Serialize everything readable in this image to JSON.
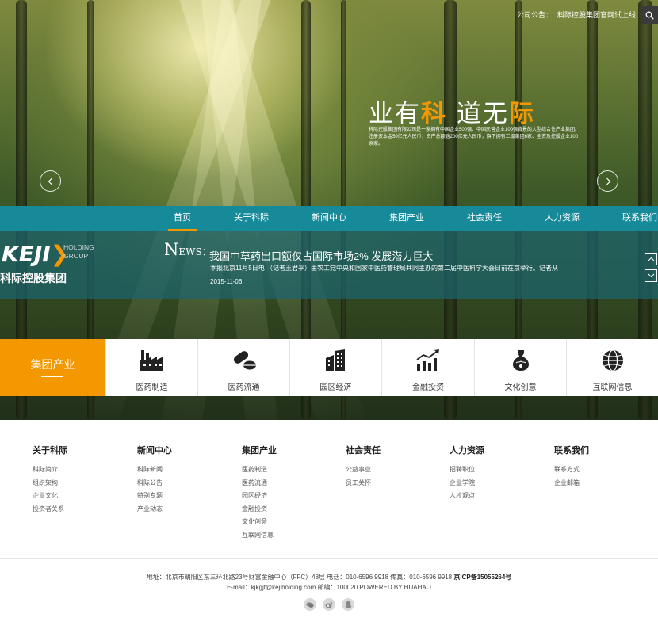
{
  "topbar": {
    "notice_label": "公司公告：",
    "notice_text": "科际控股集团官网试上线"
  },
  "hero": {
    "slogan_part1": "业有",
    "slogan_hl1": "科",
    "slogan_part2": " 道无",
    "slogan_hl2": "际",
    "slogan_desc": "科际控股集团有限公司是一家拥有中国企业500强、中国民营企业100强背景的大型综合性产业集团。注册资本金50亿元人民币，资产总额逾200亿元人民币，旗下拥有二级集团6家、全资及控股企业100余家。"
  },
  "nav": {
    "items": [
      {
        "label": "首页",
        "active": true
      },
      {
        "label": "关于科际",
        "active": false
      },
      {
        "label": "新闻中心",
        "active": false
      },
      {
        "label": "集团产业",
        "active": false
      },
      {
        "label": "社会责任",
        "active": false
      },
      {
        "label": "人力资源",
        "active": false
      },
      {
        "label": "联系我们",
        "active": false
      }
    ]
  },
  "logo": {
    "main_text": "KEJI",
    "sub_line1": "HOLDING",
    "sub_line2": "GROUP",
    "cn_name": "科际控股集团"
  },
  "news": {
    "tag_big": "N",
    "tag_rest": "EWS：",
    "title": "我国中草药出口额仅占国际市场2% 发展潜力巨大",
    "body": "本报北京11月5日电 （记者王君平）由农工党中央和国家中医药管理局共同主办的第二届中医科学大会日前在京举行。记者从",
    "date": "2015-11-06"
  },
  "industry": {
    "heading": "集团产业",
    "items": [
      {
        "label": "医药制造",
        "icon": "factory-icon"
      },
      {
        "label": "医药流通",
        "icon": "pills-icon"
      },
      {
        "label": "园区经济",
        "icon": "buildings-icon"
      },
      {
        "label": "金融投资",
        "icon": "bar-chart-icon"
      },
      {
        "label": "文化创意",
        "icon": "vase-icon"
      },
      {
        "label": "互联网信息",
        "icon": "globe-icon"
      }
    ]
  },
  "footer_links": {
    "columns": [
      {
        "title": "关于科际",
        "links": [
          "科际简介",
          "组织架构",
          "企业文化",
          "投资者关系"
        ]
      },
      {
        "title": "新闻中心",
        "links": [
          "科际新闻",
          "科际公告",
          "特别专题",
          "产业动态"
        ]
      },
      {
        "title": "集团产业",
        "links": [
          "医药制造",
          "医药流通",
          "园区经济",
          "金融投资",
          "文化创意",
          "互联网信息"
        ]
      },
      {
        "title": "社会责任",
        "links": [
          "公益事业",
          "员工关怀"
        ]
      },
      {
        "title": "人力资源",
        "links": [
          "招聘职位",
          "企业学院",
          "人才观点"
        ]
      },
      {
        "title": "联系我们",
        "links": [
          "联系方式",
          "企业邮箱"
        ]
      }
    ]
  },
  "copyright": {
    "line1_prefix": "地址：北京市朝阳区东三环北路23号财富金融中心（FFC）48层 电话：010-6596 9918 传真：010-6596 9918 ",
    "line1_icp": "京ICP备15055264号",
    "line2": "E-mail：kjkgjt@kejiholding.com 邮编：100020 POWERED BY HUAHAO"
  },
  "social": [
    "wechat-icon",
    "weibo-icon",
    "qq-icon"
  ],
  "colors": {
    "accent": "#f39800",
    "nav": "#178a9a"
  }
}
